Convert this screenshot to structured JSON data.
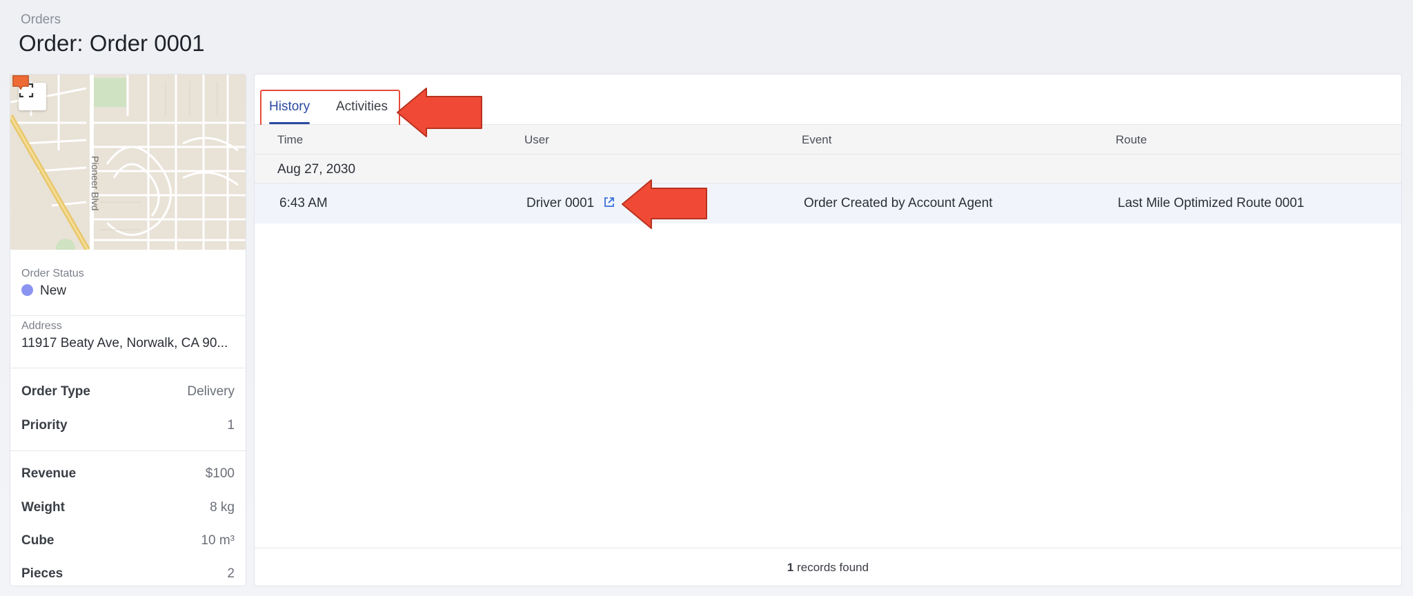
{
  "breadcrumb": "Orders",
  "page_title": "Order: Order 0001",
  "map": {
    "street_label": "Pioneer Blvd",
    "pin_color": "#ee6a35"
  },
  "order_status": {
    "label": "Order Status",
    "value": "New",
    "dot_color": "#8b93f0"
  },
  "address": {
    "label": "Address",
    "value": "11917 Beaty Ave, Norwalk, CA 90..."
  },
  "details": [
    {
      "key": "Order Type",
      "value": "Delivery"
    },
    {
      "key": "Priority",
      "value": "1"
    }
  ],
  "metrics": [
    {
      "key": "Revenue",
      "value": "$100"
    },
    {
      "key": "Weight",
      "value": "8 kg"
    },
    {
      "key": "Cube",
      "value": "10 m³"
    },
    {
      "key": "Pieces",
      "value": "2"
    }
  ],
  "tabs": [
    {
      "label": "History",
      "active": true
    },
    {
      "label": "Activities",
      "active": false
    }
  ],
  "table": {
    "columns": [
      "Time",
      "User",
      "Event",
      "Route"
    ],
    "groups": [
      {
        "date": "Aug 27, 2030",
        "rows": [
          {
            "time": "6:43 AM",
            "user": "Driver 0001",
            "event": "Order Created by Account Agent",
            "route": "Last Mile Optimized Route 0001"
          }
        ]
      }
    ]
  },
  "footer": {
    "count": "1",
    "suffix": " records found"
  },
  "colors": {
    "accent": "#2b4aa0",
    "annotation": "#f04a36",
    "link_icon": "#3a6fd8"
  }
}
